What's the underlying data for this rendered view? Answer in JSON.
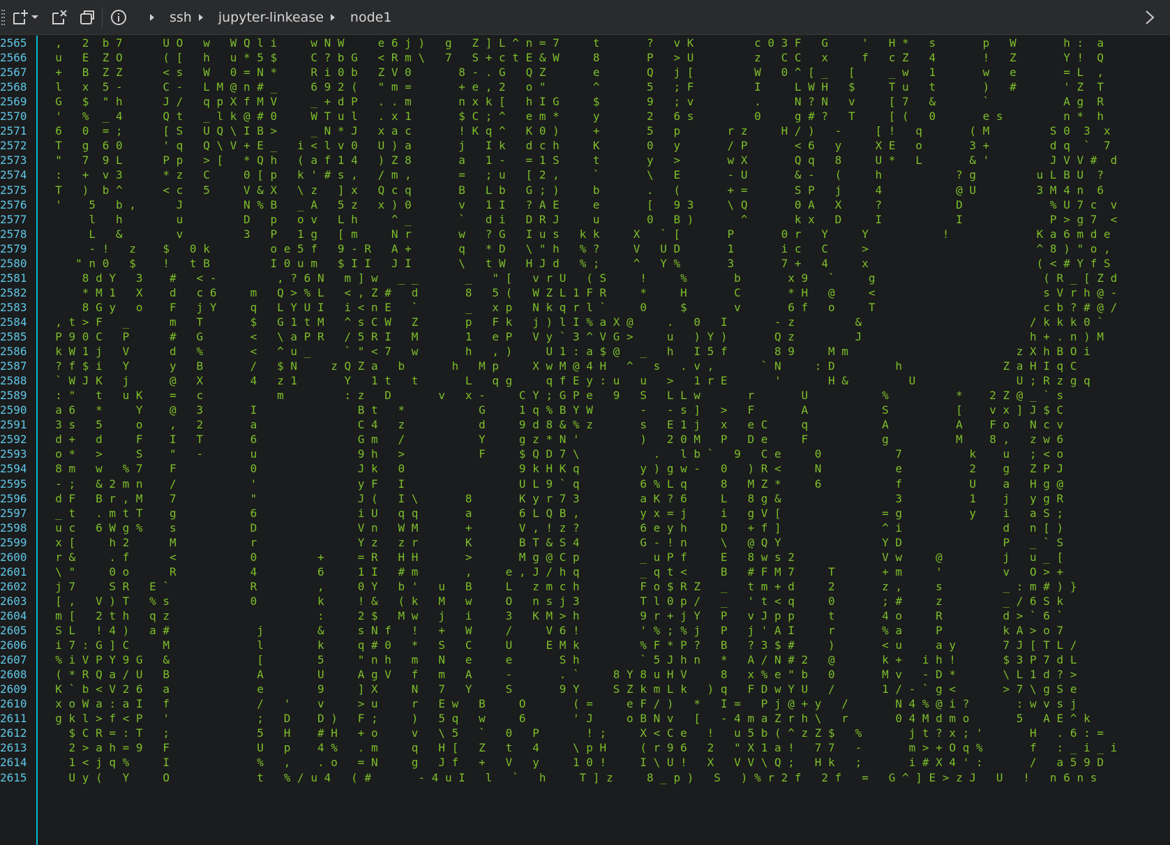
{
  "toolbar": {
    "buttons": [
      {
        "name": "new-tab-icon"
      },
      {
        "name": "dropdown-icon"
      },
      {
        "name": "detach-tab-icon"
      },
      {
        "name": "new-window-icon"
      },
      {
        "name": "info-icon"
      }
    ]
  },
  "breadcrumb": [
    "ssh",
    "jupyter-linkease",
    "node1"
  ],
  "terminal": {
    "rows": [
      {
        "ln": "2565",
        "t": "  ,   2  b 7      U O   w   W Q l i     w N W     e 6 j )   g   Z ] L ^ n = 7     t       ?   v K         c 0 3 F   G     '   H *   s       p   W       h :  a"
      },
      {
        "ln": "2566",
        "t": "  u   E  Z O      ( [   h   u * 5 $     C ? b G   < R m \\   7   S + c t E & W     8       P   > U         z   C C   x     f   c Z   4       !   Z       Y !  Q"
      },
      {
        "ln": "2567",
        "t": "  +   B  Z Z      < s   W   0 = N *     R i 0 b   Z V 0       8 - . G   Q Z       e       Q   j [         W   0 ^ [ _   [     _ w   1       w   e       = L  ,"
      },
      {
        "ln": "2568",
        "t": "  l   x  5 -      C -   L M @ n # _     6 9 2 (   \" m =       + e , 2   o \"       ^       5   ; F         I     L W H   $     T u   t       )   #       ' Z  T"
      },
      {
        "ln": "2569",
        "t": "  G   $  \" h      J /   q p X f M V     _ + d P   . . m       n x k [   h I G     $       9   ; v         .     N ? N   v     [ 7   &       `           A g  R"
      },
      {
        "ln": "2570",
        "t": "  '   %  _ 4      Q t   _ l k @ # 0     W T u l   . x 1       $ C ; ^   e m *     y       2   6 s         0     g # ?   T     [ (   0       e s         n *  h"
      },
      {
        "ln": "2571",
        "t": "  6   0  = ;      [ S   U Q \\ I B >     _ N * J   x a c       ! K q ^   K 0 )     +       5   p       r z     H / )   -     [ !   q       ( M         S 0  3  x"
      },
      {
        "ln": "2572",
        "t": "  T   g  6 0      ' q   Q \\ V + E _   i < l v 0   U ) a       j   I k   d c h     K       0   y       / P       < 6   y     X E   o       3 +         d q  `  7"
      },
      {
        "ln": "2573",
        "t": "  \"   7  9 L      P p   > [   * Q h   ( a f 1 4   ) Z 8       a   1 -   = 1 S     t       y   >       w X       Q q   8     U *   L       & '         J V V #  d"
      },
      {
        "ln": "2574",
        "t": "  :   +  v 3      * z   C     0 [ p   k ' # s ,   / m ,       =   ; u   [ 2 ,     `       \\   E       - U       & -   (     h           ? g         u L B U  ?"
      },
      {
        "ln": "2575",
        "t": "  T   )  b ^      < c   5     V & X   \\ z   ] x   Q c q       B   L b   G ; )     b       .   (       + =       S P   j     4           @ U         3 M 4 n  6"
      },
      {
        "ln": "2576",
        "t": "  '    5   b ,      J         N % B   _ A   5 z   x ) 0       v   1 I   ? A E     e       [   9 3     \\ Q       0 A   X     ?           D             % U 7 c  v"
      },
      {
        "ln": "2577",
        "t": "       l   h        u         D   p   o v   L h     ^ _       `   d i   D R J     u       0   B )       ^       k x   D     I           I             P > g 7  <"
      },
      {
        "ln": "2578",
        "t": "       L   &        v         3   P   1 g   [ m     N r       w   ? G   I u s   k k     X   ` [       P       0 r   Y     Y           !             K a 6 m d e"
      },
      {
        "ln": "2579",
        "t": "       - !   z    $   0 k         o e 5 f   9 - R   A +       q   * D   \\ \" h   % ?     V   U D       1       i c   C     >                         ^ 8 ) \" o ,"
      },
      {
        "ln": "2580",
        "t": "     \" n 0   $    !   t B         I 0 u m   $ I I   J I       \\   t W   H J d   % ;     ^   Y %       3       7 +   4     x                         ( < # Y f S"
      },
      {
        "ln": "2581",
        "t": "      8 d Y   3    #   < -         , ? 6 N   m ] w   _ _       _   \" [   v r U   ( S     !     %       b       x 9   `     g                         ( R _ [ Z d"
      },
      {
        "ln": "2582",
        "t": "      * M 1   X    d   c 6     m   Q > % L   < , Z #   d       8   5 (   W Z L 1 F R     *     H       C       * H   @     <                         s V r h @ -"
      },
      {
        "ln": "2583",
        "t": "      8 G y   o    F   j Y     q   L Y U I   i < n E   `       _   x p   N k q r l `     0     $       v       6 f   o     T                         c b ? # @ /"
      },
      {
        "ln": "2584",
        "t": "  , t > F   _      m   T       $   G 1 t M   ^ s C W   Z       p   F k   j ) l I % a X @     .   0   I       - z         &                         / k k k 0 `"
      },
      {
        "ln": "2585",
        "t": "  P 9 0 C   P      #   G       <   \\ a P R   / 5 R I   M       1   e P   V y ` 3 ^ V G >     u   ) Y )       Q z         J                         h + . n ) M"
      },
      {
        "ln": "2586",
        "t": "  k W 1 j   V      d   %       <   ^ u _     ` \" < 7   w       h   , )     U 1 : a $ @   _   h   I 5 f       8 9     M m                         z X h B O i"
      },
      {
        "ln": "2587",
        "t": "  ? f $ i   Y      y   B       /   $ N     z Q Z a   b       h   M p     X w M @ 4 H   ^   s   . v ,       ` N     : D         h               Z a H I q C"
      },
      {
        "ln": "2588",
        "t": "  ` W J K   j      @   X       4   z 1       Y   1 t   t       L   q g     q f E y : u   u   >   1 r E       '       H &         U               U ; R z g q"
      },
      {
        "ln": "2589",
        "t": "  : \"   t   u K    =   c           m         : z   D       v   x -     C Y ; G P e   9   S   L L w       r       U           %          *    2 Z @ _ ` s"
      },
      {
        "ln": "2590",
        "t": "  a 6   *     Y    @   3       I               B t   *           G     1 q % B Y W       -   - s ]   >   F       A           S          [    v x ] J $ C"
      },
      {
        "ln": "2591",
        "t": "  3 s   5     o    ,   2       a               C 4   z           d     9 d 8 & % z       s   E 1 j   x   e C     q           A          A    F o   N c v"
      },
      {
        "ln": "2592",
        "t": "  d +   d     F    I   T       6               G m   /           Y     g z * N '         )   2 0 M   P   D e     F           g          M    8 ,   z w 6"
      },
      {
        "ln": "2593",
        "t": "  o *   >     S    \"   -       u               9 h   >           F     $ Q D 7 \\           .   l b `   9   C e     0           7          k    u   ; < o"
      },
      {
        "ln": "2594",
        "t": "  8 m   w   % 7    F           0               J k   0                 9 k H K q         y ) g w -   0   ) R <     N           e          2    g   Z P J"
      },
      {
        "ln": "2595",
        "t": "  - ;   & 2 m n    /           '               y F   I                 U L 9 ` q         6 % L q     8   M Z *     6           f          U    a   H g @"
      },
      {
        "ln": "2596",
        "t": "  d F   B r , M    7           \"               J (   I \\       8       K y r 7 3         a K ? 6     L   8 g &                 3          1    j   y g R"
      },
      {
        "ln": "2597",
        "t": "  _ t   . m t T    g           6               i U   q q       a       6 L Q B ,         y x = j     i   g V [               = g          y    i   a S ;"
      },
      {
        "ln": "2598",
        "t": "  u c   6 W g %    s           D               V n   W M       +       V , ! z ?         6 e y h     D   + f ]               ^ i               d   n [ )"
      },
      {
        "ln": "2599",
        "t": "  x [     h 2      M           r               Y z   z r       K       B T & S 4         G - ! n     \\   @ Q Y               Y D               P   _ ` S"
      },
      {
        "ln": "2600",
        "t": "  r &     . f      <           0         +     = R   H H       >       M g @ C p         _ u P f     E   8 w s 2             V w     @         j   u _ ["
      },
      {
        "ln": "2601",
        "t": "  \\ \"     0 o      R           4         6     1 I   # m       ,     e , J / h q         _ q t <     B   # F M 7     T       + m     '         v   O > +"
      },
      {
        "ln": "2602",
        "t": "  j 7     S R   E `            R         ,     0 Y   b '   u   B     L   z m c h         F o $ R Z   _   t m + d     2       z ,     s         _ : m # ) }"
      },
      {
        "ln": "2603",
        "t": "  [ ,   V ) T   % s            0         k     ! &   ( k   M   w     O   n s j 3         T l 0 p /   _   ' t < q     0       ; #     z         _ / 6 S k"
      },
      {
        "ln": "2604",
        "t": "  m [   2 t h   q z                      :     2 $   M w   j   i     3   K M > h         9 r + j Y   P   v J p p     t       4 o     R         d > ` 6 `"
      },
      {
        "ln": "2605",
        "t": "  S L   ! 4 )   a #             j        &     s N f   !   +   W     /     V 6 !         ' % ; % j   P   j ' A I     r       % a     P         k A > o 7"
      },
      {
        "ln": "2606",
        "t": "  i 7 : G ] C     M             l        k     q # 0   *   S   C     U     E M k         % F * P ?   B   ? 3 $ #     )       < u     a y       7 J [ T L /"
      },
      {
        "ln": "2607",
        "t": "  % i V P Y 9 G   &             [        5     \" n h   m   N   e     e       S h         ` 5 J h n   *   A / N # 2   @       k +   i h !       $ 3 P 7 d L"
      },
      {
        "ln": "2608",
        "t": "  ( * R Q a / U   B             A        U     A g V   f   m   A     -       . `     8 Y 8 u H V     8   x % e \" b   0       M v   - D *       \\ L 1 d ? >"
      },
      {
        "ln": "2609",
        "t": "  K ` b < V 2 6   a             e        9     ] X     N   7   Y     S       9 Y     S Z k m L k   ) q   F D w Y U   /       1 / - ` g <       > 7 \\ g S e"
      },
      {
        "ln": "2610",
        "t": "  x o W a : a I   f             /   '    v     > u     r   E w   B     O       ( =     e F / )   *   I =   P j @ + y   /       N 4 % @ i ?       : w v s j"
      },
      {
        "ln": "2611",
        "t": "  g k l > f < P   '             ;   D    D )   F ;     )   5 q   w     6       ' J     o B N v   [   - 4 m a Z r h \\   r       0 4 M d m o       5   A E ^ k"
      },
      {
        "ln": "2612",
        "t": "    $ C R = : T   ;             5   H    # H   + o     v   \\ 5   `   0   P       ! ;     X < C e   !   u 5 b ( ^ z Z $   %       j t ? x ; '       H   . 6 : ="
      },
      {
        "ln": "2613",
        "t": "    2 > a h = 9   F             U   p    4 %   . m     q   H [   Z   t   4     \\ p H     ( r 9 6   2   \" X 1 a !   7 7   -       m > + O q %       f   : _ i _ i"
      },
      {
        "ln": "2614",
        "t": "    1 < j q %     I             %   ,    . o   = N     g   J f   +   V   y     1 0 !     I \\ U !   X   V V \\ Q ;   H k   ;       i # X 4 ' :       /   a 5 9 D"
      },
      {
        "ln": "2615",
        "t": "    U y (   Y     O             t   % / u 4   ( #       - 4 u I   l   `   h     T ] z     8 _ p )   S   ) % r 2 f   2 f   =   G ^ ] E > z J   U   !   n 6 n s"
      }
    ]
  }
}
